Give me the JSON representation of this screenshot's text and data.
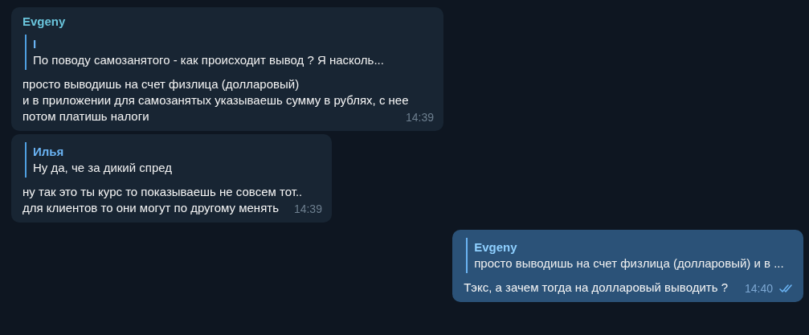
{
  "messages": [
    {
      "outgoing": false,
      "sender": "Evgeny",
      "reply": {
        "name": "I",
        "text": "По поводу самозанятого - как происходит вывод ? Я насколь..."
      },
      "lines": [
        "просто выводишь на счет физлица (долларовый)",
        "и в приложении для самозанятых указываешь сумму в рублях, с нее потом платишь налоги"
      ],
      "time": "14:39"
    },
    {
      "outgoing": false,
      "reply": {
        "name": "Илья",
        "text": "Ну да, че за дикий спред"
      },
      "lines": [
        "ну так это ты курс то показываешь не совсем тот..",
        "для клиентов то они могут по другому менять"
      ],
      "time": "14:39"
    },
    {
      "outgoing": true,
      "reply": {
        "name": "Evgeny",
        "text": "просто выводишь на счет физлица (долларовый) и в ..."
      },
      "lines": [
        "Тэкс, а зачем тогда на долларовый выводить ?"
      ],
      "time": "14:40",
      "read": true
    }
  ]
}
